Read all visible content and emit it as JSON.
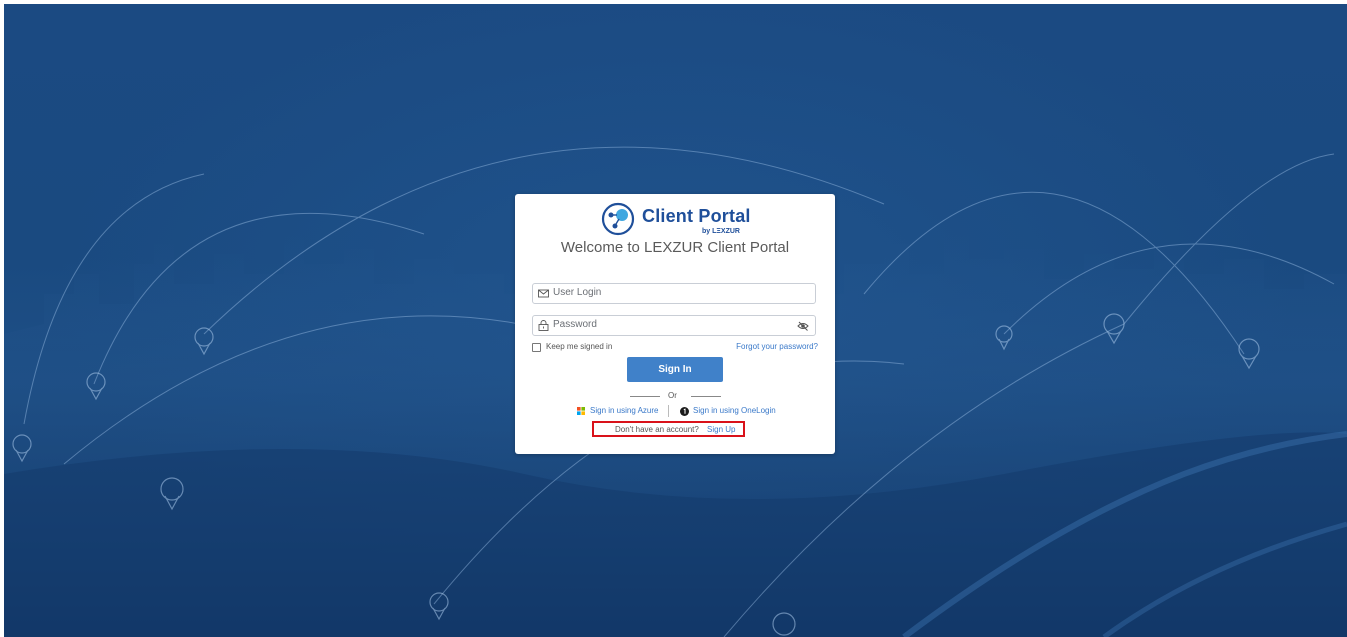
{
  "brand": {
    "name": "Client Portal",
    "byline": "by LΞXZUR",
    "colors": {
      "primary": "#1f4f9a",
      "accent": "#4081c9",
      "link": "#3a79c9",
      "highlight": "#d9121a"
    }
  },
  "welcome": "Welcome to LEXZUR Client Portal",
  "login": {
    "user_placeholder": "User Login",
    "password_placeholder": "Password",
    "keep_signed_in": "Keep me signed in",
    "keep_signed_in_checked": false,
    "forgot": "Forgot your password?",
    "sign_in": "Sign In"
  },
  "or": "Or",
  "sso": {
    "azure": "Sign in using Azure",
    "onelogin": "Sign in using OneLogin"
  },
  "signup": {
    "question": "Don't have an account?",
    "link": "Sign Up"
  },
  "icons": {
    "logo": "client-portal-logo",
    "user": "envelope-icon",
    "password": "lock-icon",
    "toggle": "eye-slash-icon",
    "azure": "microsoft-logo-icon",
    "onelogin": "onelogin-icon"
  }
}
